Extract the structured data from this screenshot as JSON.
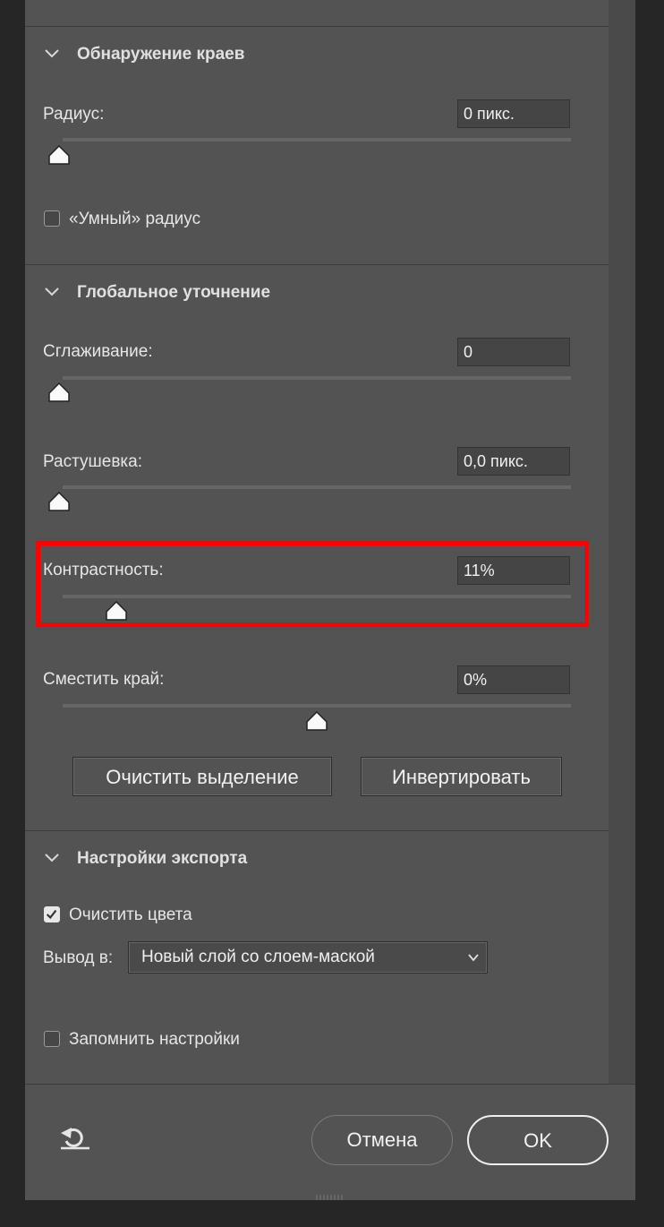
{
  "edge_detection": {
    "title": "Обнаружение краев",
    "radius_label": "Радиус:",
    "radius_value": "0 пикс.",
    "radius_level": 0,
    "smart_radius_label": "«Умный» радиус",
    "smart_radius_checked": false
  },
  "global_refinement": {
    "title": "Глобальное уточнение",
    "smooth_label": "Сглаживание:",
    "smooth_value": "0",
    "smooth_level": 0,
    "feather_label": "Растушевка:",
    "feather_value": "0,0 пикс.",
    "feather_level": 0,
    "contrast_label": "Контрастность:",
    "contrast_value": "11%",
    "contrast_level": 0.11,
    "shift_edge_label": "Сместить край:",
    "shift_edge_value": "0%",
    "shift_edge_level": 0.5,
    "clear_selection_label": "Очистить выделение",
    "invert_label": "Инвертировать"
  },
  "export_settings": {
    "title": "Настройки экспорта",
    "decontaminate_label": "Очистить цвета",
    "decontaminate_checked": true,
    "output_label": "Вывод в:",
    "output_value": "Новый слой со слоем-маской",
    "remember_label": "Запомнить настройки",
    "remember_checked": false
  },
  "footer": {
    "cancel_label": "Отмена",
    "ok_label": "OK"
  },
  "colors": {
    "panel_bg": "#535353",
    "highlight": "#ff0000"
  }
}
